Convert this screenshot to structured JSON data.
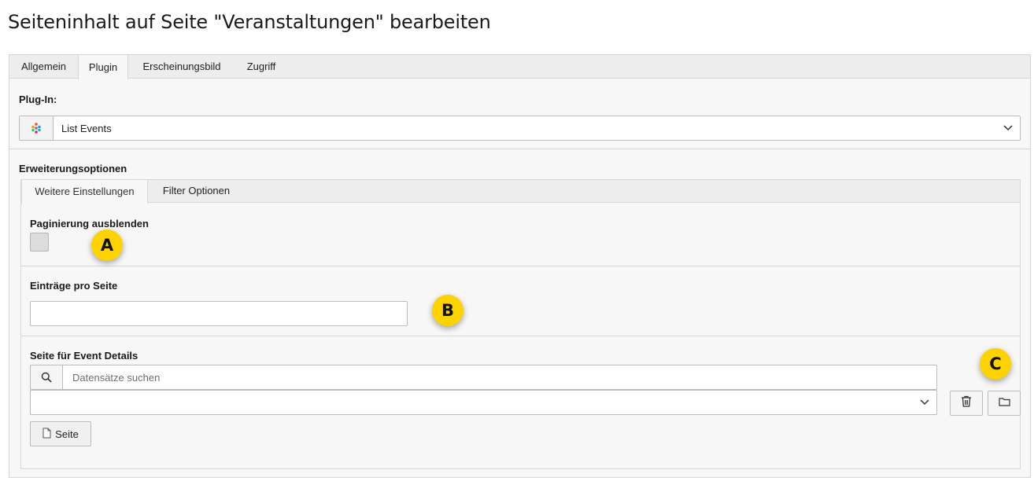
{
  "page": {
    "title": "Seiteninhalt auf Seite \"Veranstaltungen\" bearbeiten"
  },
  "tabs": [
    {
      "label": "Allgemein",
      "active": false
    },
    {
      "label": "Plugin",
      "active": true
    },
    {
      "label": "Erscheinungsbild",
      "active": false
    },
    {
      "label": "Zugriff",
      "active": false
    }
  ],
  "plugin": {
    "label": "Plug-In:",
    "selected": "List Events",
    "icon": "plugin-dots-icon"
  },
  "extension": {
    "label": "Erweiterungsoptionen",
    "tabs": [
      {
        "label": "Weitere Einstellungen",
        "active": true
      },
      {
        "label": "Filter Optionen",
        "active": false
      }
    ]
  },
  "fields": {
    "hide_pagination": {
      "label": "Paginierung ausblenden",
      "checked": false
    },
    "items_per_page": {
      "label": "Einträge pro Seite",
      "value": ""
    },
    "detail_page": {
      "label": "Seite für Event Details",
      "search_placeholder": "Datensätze suchen",
      "selected": "",
      "page_button_label": "Seite"
    }
  },
  "markers": {
    "a": "A",
    "b": "B",
    "c": "C"
  },
  "colors": {
    "marker": "#fcd200",
    "panel": "#f7f7f7",
    "tabbar": "#ededed",
    "border": "#d7d7d7"
  }
}
